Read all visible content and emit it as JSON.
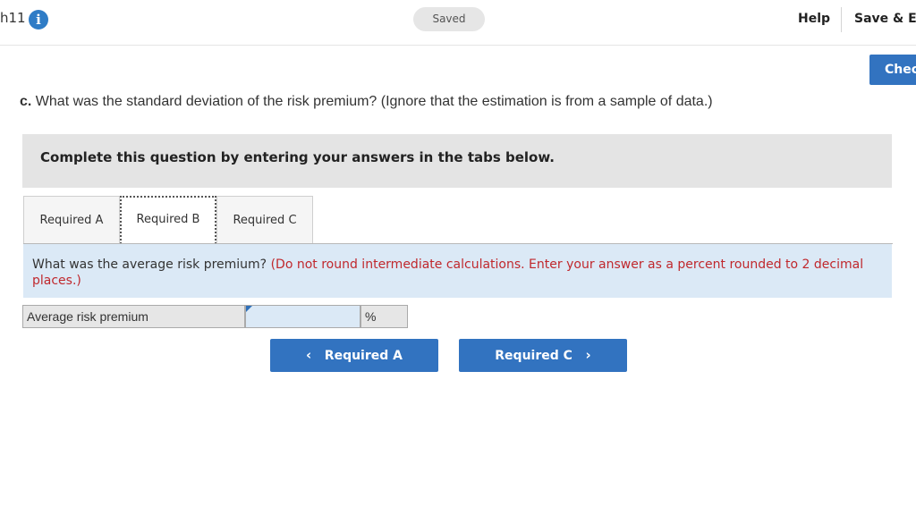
{
  "header": {
    "chapter_label": "h11",
    "info_icon": "info-icon",
    "status": "Saved",
    "help": "Help",
    "save_exit": "Save & Ex",
    "check": "Chec"
  },
  "question": {
    "prefix": "c.",
    "text": "What was the standard deviation of the risk premium? (Ignore that the estimation is from a sample of data.)"
  },
  "instruction": "Complete this question by entering your answers in the tabs below.",
  "tabs": [
    {
      "label": "Required A",
      "active": false
    },
    {
      "label": "Required B",
      "active": true
    },
    {
      "label": "Required C",
      "active": false
    }
  ],
  "prompt": {
    "question": "What was the average risk premium?",
    "note": "(Do not round intermediate calculations. Enter your answer as a percent rounded to 2 decimal places.)"
  },
  "answer": {
    "label": "Average risk premium",
    "value": "",
    "unit": "%"
  },
  "nav": {
    "prev_label": "Required A",
    "next_label": "Required C",
    "prev_icon": "chevron-left-icon",
    "next_icon": "chevron-right-icon"
  },
  "colors": {
    "accent": "#3273c0",
    "instruction_bg": "#e4e4e4",
    "prompt_bg": "#dbe9f6",
    "note_red": "#c0282d"
  }
}
